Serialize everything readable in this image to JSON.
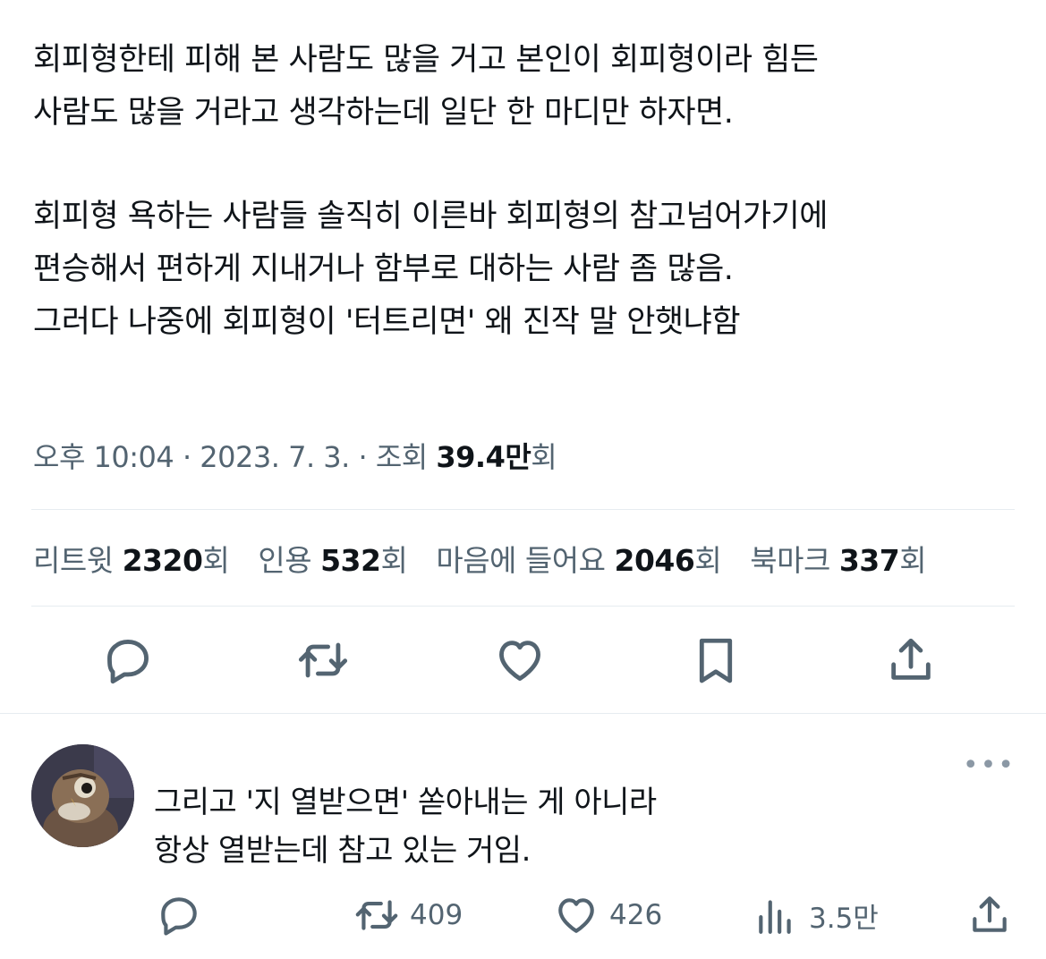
{
  "tweet": {
    "lines": [
      "회피형한테 피해 본 사람도 많을 거고 본인이 회피형이라 힘든",
      "사람도 많을 거라고 생각하는데 일단 한 마디만 하자면.",
      "회피형 욕하는 사람들 솔직히 이른바 회피형의 참고넘어가기에",
      "편승해서 편하게 지내거나 함부로 대하는 사람 좀 많음.",
      "그러다 나중에 회피형이 '터트리면' 왜 진작 말 안햇냐함"
    ],
    "meta": {
      "time": "오후 10:04",
      "sep": " · ",
      "date": "2023. 7. 3.",
      "views_label": "조회",
      "views_value": "39.4만",
      "views_unit": "회"
    },
    "stats": {
      "retweets_label": "리트윗",
      "retweets_value": "2320",
      "retweets_unit": "회",
      "quotes_label": "인용",
      "quotes_value": "532",
      "quotes_unit": "회",
      "likes_label": "마음에 들어요",
      "likes_value": "2046",
      "likes_unit": "회",
      "bookmarks_label": "북마크",
      "bookmarks_value": "337",
      "bookmarks_unit": "회"
    },
    "actions": [
      "reply-icon",
      "retweet-icon",
      "like-icon",
      "bookmark-icon",
      "share-icon"
    ]
  },
  "reply": {
    "more_label": "•••",
    "lines": [
      "그리고 '지 열받으면' 쏟아내는 게 아니라",
      "항상 열받는데 참고 있는 거임."
    ],
    "retweets": "409",
    "likes": "426",
    "views": "3.5만"
  },
  "colors": {
    "text": "#0f1419",
    "secondary": "#536471",
    "divider": "#e6ecf0"
  }
}
